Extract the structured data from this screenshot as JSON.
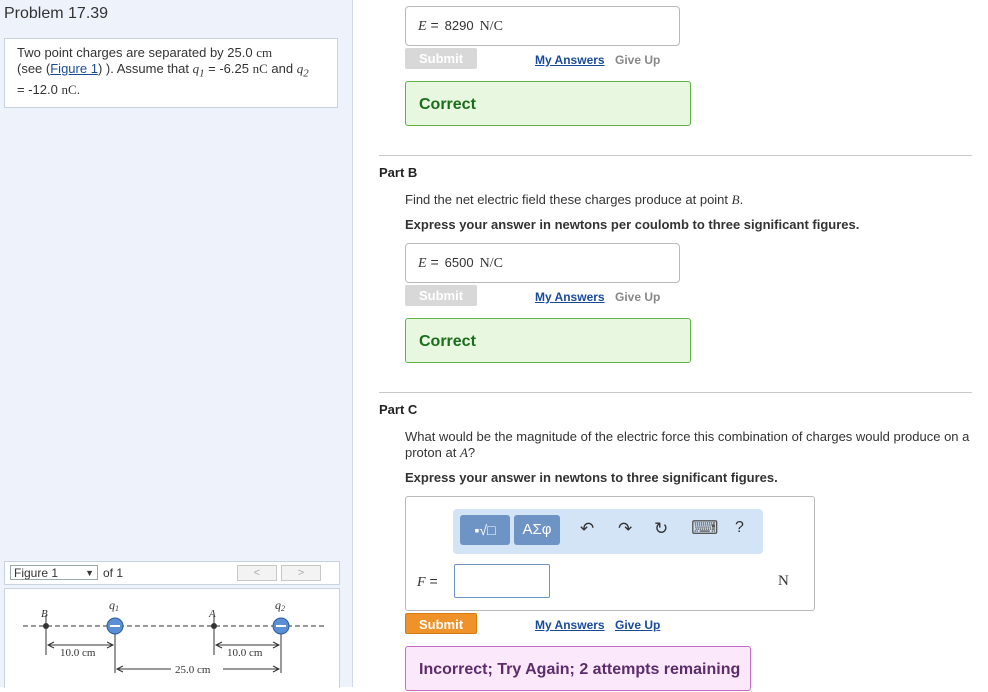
{
  "problem": {
    "title": "Problem 17.39",
    "text_a": "Two point charges are separated by 25.0",
    "unit_cm": "cm",
    "text_b": "(see (",
    "figure_link": "Figure 1",
    "text_c": ") ). Assume that",
    "q1_sym": "q",
    "q1_sub": "1",
    "eq1": " = -6.25 ",
    "nC1": "nC",
    "and": " and ",
    "q2_sym": "q",
    "q2_sub": "2",
    "eq2": "= -12.0 ",
    "nC2": "nC",
    "end": "."
  },
  "figure": {
    "select_value": "Figure 1",
    "of_label": "of 1",
    "prev": "<",
    "next": ">",
    "label_B": "B",
    "label_A": "A",
    "label_q1": "q",
    "label_q1_sub": "1",
    "label_q2": "q",
    "label_q2_sub": "2",
    "dim1": "10.0 cm",
    "dim2": "10.0 cm",
    "dim3": "25.0 cm"
  },
  "part_a": {
    "var": "E",
    "eq": "=",
    "value": "8290",
    "unit": "N/C",
    "submit": "Submit",
    "my_answers": "My Answers",
    "give_up": "Give Up",
    "feedback": "Correct"
  },
  "part_b": {
    "title": "Part B",
    "question_pre": "Find the net electric field these charges produce at point ",
    "question_var": "B",
    "question_post": ".",
    "instruction": "Express your answer in newtons per coulomb to three significant figures.",
    "var": "E",
    "eq": "=",
    "value": "6500",
    "unit": "N/C",
    "submit": "Submit",
    "my_answers": "My Answers",
    "give_up": "Give Up",
    "feedback": "Correct"
  },
  "part_c": {
    "title": "Part C",
    "question_pre": "What would be the magnitude of the electric force this combination of charges would produce on a proton at ",
    "question_var": "A",
    "question_post": "?",
    "instruction": "Express your answer in newtons to three significant figures.",
    "toolbar_templates": "▪√□",
    "toolbar_greek": "ΑΣφ",
    "undo": "↶",
    "redo": "↷",
    "reset": "↻",
    "keyboard": "⌨",
    "help": "?",
    "var": "F",
    "eq": "=",
    "value": "",
    "unit": "N",
    "submit": "Submit",
    "my_answers": "My Answers",
    "give_up": "Give Up",
    "feedback": "Incorrect; Try Again; 2 attempts remaining"
  }
}
